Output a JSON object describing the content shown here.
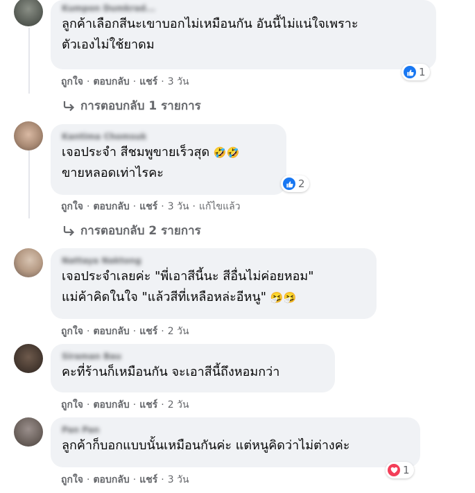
{
  "colors": {
    "like_blue": "#1877f2",
    "love_red": "#f33e58",
    "bubble_bg": "#f0f2f5",
    "meta_gray": "#65676b"
  },
  "actions_labels": {
    "like": "ถูกใจ",
    "reply": "ตอบกลับ",
    "share": "แชร์",
    "separator": "·"
  },
  "comments": [
    {
      "author": "Kumpon Dumkrad...",
      "line1": "ลูกค้าเลือกสีนะเขาบอกไม่เหมือนกัน อันนี้ไม่แน่ใจเพราะ",
      "line2": "ตัวเองไม่ใช้ยาดม",
      "reaction_icon": "like-icon",
      "reaction_count": "1",
      "time": "3 วัน",
      "replies": "การตอบกลับ 1 รายการ"
    },
    {
      "author": "Kantima Chomsuk",
      "line1": "เจอประจำ สีชมพูขายเร็วสุด",
      "line1_emoji": "🤣🤣",
      "line2": "ขายหลอดเท่าไรคะ",
      "reaction_icon": "like-icon",
      "reaction_count": "2",
      "time": "3 วัน",
      "edited": "แก้ไขแล้ว",
      "replies": "การตอบกลับ 2 รายการ"
    },
    {
      "author": "Nattaya Naktong",
      "line1": "เจอประจำเลยค่ะ \"พี่เอาสีนี้นะ สีอื่นไม่ค่อยหอม\"",
      "line2": "แม่ค้าคิดในใจ \"แล้วสีที่เหลือหล่ะอีหนู\"",
      "line2_emoji": "🤧🤧",
      "time": "2 วัน"
    },
    {
      "author": "Siraman Bau",
      "line1": "คะที่ร้านก็เหมือนกัน จะเอาสีนี้ถึงหอมกว่า",
      "time": "2 วัน"
    },
    {
      "author": "Pan Pan",
      "line1": "ลูกค้าก็บอกแบบนั้นเหมือนกันค่ะ แต่หนูคิดว่าไม่ต่างค่ะ",
      "reaction_icon": "heart-icon",
      "reaction_count": "1",
      "time": "3 วัน"
    }
  ]
}
